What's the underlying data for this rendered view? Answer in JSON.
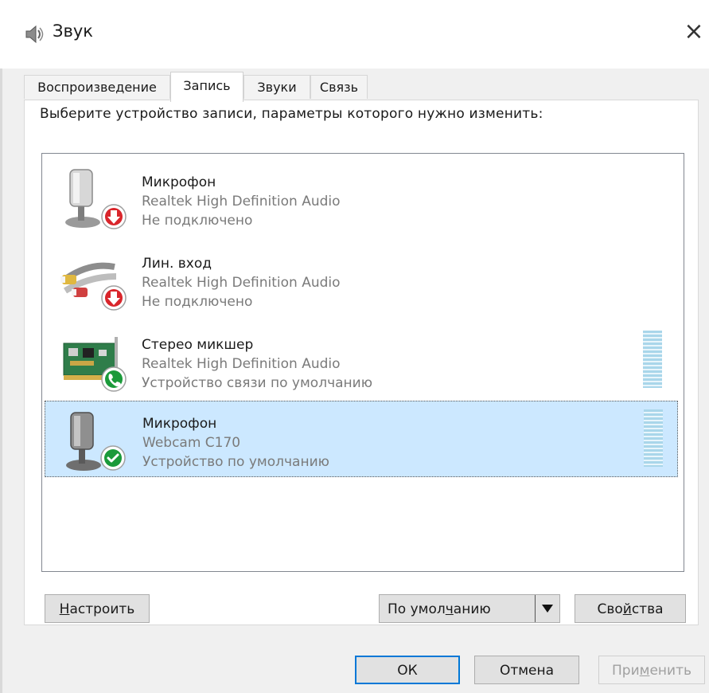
{
  "window": {
    "title": "Звук",
    "close_glyph": "×"
  },
  "tabs": [
    {
      "label": "Воспроизведение",
      "active": false
    },
    {
      "label": "Запись",
      "active": true
    },
    {
      "label": "Звуки",
      "active": false
    },
    {
      "label": "Связь",
      "active": false
    }
  ],
  "instruction": "Выберите устройство записи, параметры которого нужно изменить:",
  "devices": [
    {
      "name": "Микрофон",
      "driver": "Realtek High Definition Audio",
      "status": "Не подключено",
      "icon": "microphone-icon",
      "badge": "red-down-arrow-badge",
      "selected": false
    },
    {
      "name": "Лин. вход",
      "driver": "Realtek High Definition Audio",
      "status": "Не подключено",
      "icon": "line-in-cable-icon",
      "badge": "red-down-arrow-badge",
      "selected": false
    },
    {
      "name": "Стерео микшер",
      "driver": "Realtek High Definition Audio",
      "status": "Устройство связи по умолчанию",
      "icon": "sound-card-icon",
      "badge": "green-phone-badge",
      "selected": false
    },
    {
      "name": "Микрофон",
      "driver": "Webcam C170",
      "status": "Устройство по умолчанию",
      "icon": "microphone-icon",
      "badge": "green-check-badge",
      "selected": true
    }
  ],
  "buttons": {
    "configure": {
      "before": "",
      "u": "Н",
      "after": "астроить"
    },
    "set_default": {
      "before": "По умол",
      "u": "ч",
      "after": "анию"
    },
    "properties": {
      "before": "Сво",
      "u": "й",
      "after": "ства"
    },
    "ok": "ОК",
    "cancel": "Отмена",
    "apply": {
      "before": "При",
      "u": "м",
      "after": "енить"
    }
  },
  "colors": {
    "selection": "#cce8ff",
    "accent": "#0078d7",
    "badge_red": "#d9252b",
    "badge_green": "#1b9a3a"
  }
}
